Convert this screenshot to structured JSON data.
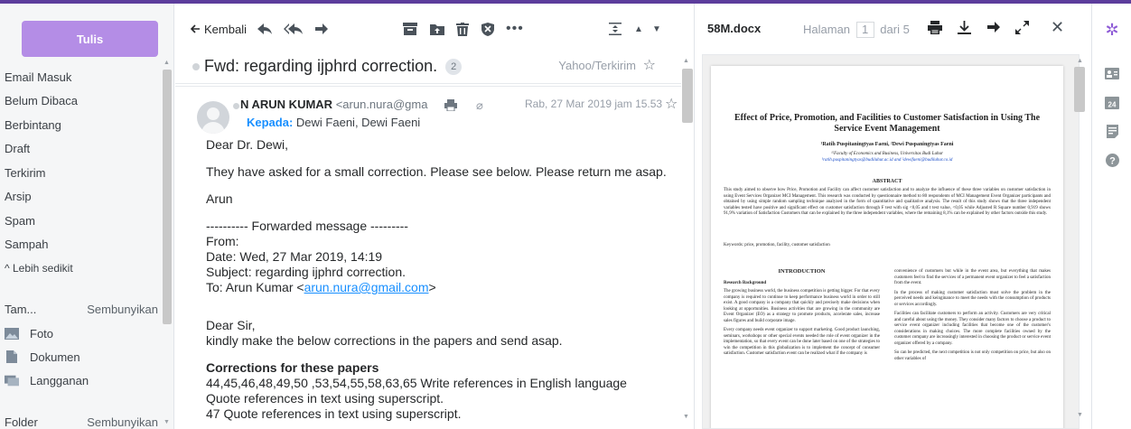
{
  "sidebar": {
    "compose_label": "Tulis",
    "folders": [
      {
        "name": "inbox",
        "label": "Email Masuk"
      },
      {
        "name": "unread",
        "label": "Belum Dibaca"
      },
      {
        "name": "starred",
        "label": "Berbintang"
      },
      {
        "name": "drafts",
        "label": "Draft"
      },
      {
        "name": "sent",
        "label": "Terkirim"
      },
      {
        "name": "archive",
        "label": "Arsip"
      },
      {
        "name": "spam",
        "label": "Spam"
      },
      {
        "name": "trash",
        "label": "Sampah"
      }
    ],
    "less_label": "^ Lebih sedikit",
    "views_label": "Tam...",
    "views_hide": "Sembunyikan",
    "views": [
      {
        "name": "photos",
        "label": "Foto",
        "icon": "photo-icon"
      },
      {
        "name": "documents",
        "label": "Dokumen",
        "icon": "document-icon"
      },
      {
        "name": "subscriptions",
        "label": "Langganan",
        "icon": "subscription-icon"
      }
    ],
    "folders_label": "Folder",
    "folders_hide": "Sembunyikan"
  },
  "toolbar": {
    "back_label": "Kembali"
  },
  "message": {
    "subject": "Fwd: regarding ijphrd correction.",
    "count": "2",
    "folder_tag": "Yahoo/Terkirim",
    "sender_name": "N ARUN KUMAR",
    "sender_email": "<arun.nura@gma",
    "date": "Rab, 27 Mar 2019 jam 15.53",
    "to_label": "Kepada:",
    "to_value": "Dewi Faeni,  Dewi Faeni",
    "body": {
      "greeting": "Dear Dr. Dewi,",
      "line1": "They have asked for a small correction. Please see below. Please return me asap.",
      "signature": "Arun",
      "fwd_header": "---------- Forwarded message ---------",
      "from": "From:",
      "date": "Date: Wed, 27 Mar 2019, 14:19",
      "subject": "Subject: regarding ijphrd correction.",
      "to_prefix": "To: Arun Kumar <",
      "to_email": "arun.nura@gmail.com",
      "to_suffix": ">",
      "salutation": "Dear Sir,",
      "request": "kindly make the below corrections in the papers and send asap.",
      "corrections_heading": "Corrections for these papers",
      "c1": "44,45,46,48,49,50 ,53,54,55,58,63,65  Write references in English language",
      "c2": "Quote references in text using superscript.",
      "c3": "47 Quote references in text using superscript."
    }
  },
  "viewer": {
    "filename": "58M.docx",
    "page_label": "Halaman",
    "page_current": "1",
    "page_of": "dari 5"
  },
  "document": {
    "title": "Effect of Price, Promotion, and Facilities to Customer Satisfaction in Using The Service Event Management",
    "authors": "¹Ratih Puspitaningtyas Faeni, ²Dewi Puspaningtyas Faeni",
    "affiliation": "¹²Faculty of Economics and Business, Universitas Budi Luhur",
    "emails": "¹ratih.puspitaningtyas@budiluhur.ac.id and ²dewifaeni@budiluhur.co.id",
    "abstract_heading": "ABSTRACT",
    "abstract": "This study aimed to observe how Price, Promotion and Facility can affect customer satisfaction and to analyze the influence of these three variables on customer satisfaction in using Event Services Organizer MCI Management. This research was conducted by questionnaire method to 80 respondents of MCI Management Event Organizer participants and obtained by using simple random sampling technique analyzed in the form of quantitative and qualitative analysis. The result of this study shows that the three independent variables tested have positive and significant effect on customer satisfaction through F test with sig <0,05 and t test value, <0,05 while Adjusted R Square number 0,919 shows 91,9% variation of Satisfaction Customers that can be explained by the three independent variables, where the remaining 8,1% can be explained by other factors outside this study.",
    "keywords": "Keywords: price, promotion, facility, customer satisfaction",
    "intro_heading": "INTRODUCTION",
    "research_heading": "Research Background",
    "left_p1": "The growing business world, the business competition is getting bigger. For that every company is required to continue to keep performance business world in order to still exist. A good company is a company that quickly and precisely make decisions when looking at opportunities. Business activities that are growing in the community are Event Organizer (EO) as a strategy to promote products, accelerate sales, increase sales figures and build corporate image.",
    "left_p2": "Every company needs event organizer to support marketing. Good product launching, seminars, workshops or other special events needed the role of event organizer in the implementation, so that every event can be done later based on one of the strategies to win the competition in this globalization is to implement the concept of consumer satisfaction. Customer satisfaction event can be realized what if the company is",
    "right_p1": "convenience of customers but while in the event area, but everything that makes customers feel to find the services of a permanent event organizer to feel a satisfaction from the event.",
    "right_p2": "In the process of making customer satisfaction must solve the problem in the perceived needs and keinginance to meet the needs with the consumption of products or services accordingly.",
    "right_p3": "Facilities can facilitate customers to perform an activity. Customers are very critical and careful about using the money. They consider many factors to choose a product to service event organizer including facilities that become one of the customer's considerations in making choices. The more complete facilities owned by the customer company are increasingly interested in choosing the product or service event organizer offered by a company.",
    "right_p4": "So can be predicted, the next competition is not only competition on price, but also on other variables of"
  },
  "colors": {
    "accent": "#5c3d9c",
    "compose": "#b48de6",
    "link": "#188fff"
  }
}
